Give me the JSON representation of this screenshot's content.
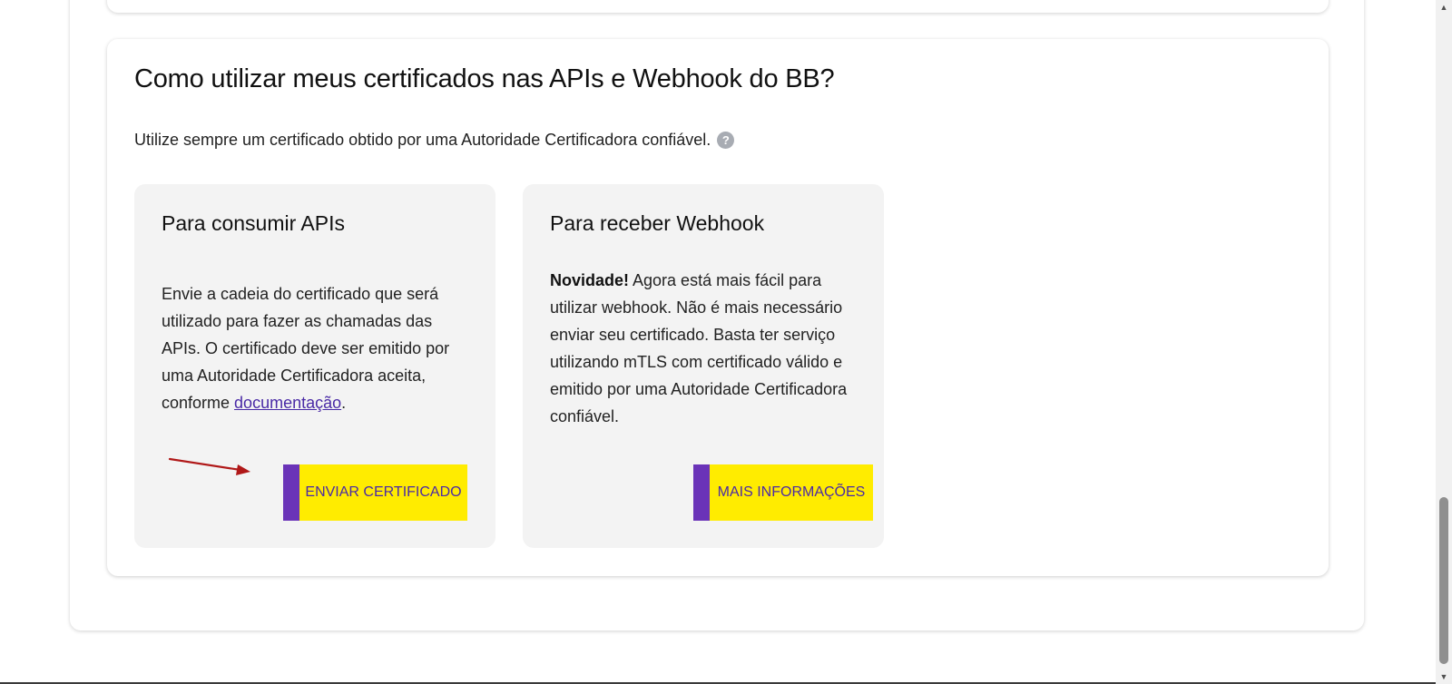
{
  "main_card": {
    "title": "Como utilizar meus certificados nas APIs e Webhook do BB?",
    "subtitle": "Utilize sempre um certificado obtido por uma Autoridade Certificadora confiável.",
    "help_icon_glyph": "?"
  },
  "api_card": {
    "title": "Para consumir APIs",
    "body_text": "Envie a cadeia do certificado que será utilizado para fazer as chamadas das APIs. O certificado deve ser emitido por uma Autoridade Certificadora aceita, conforme ",
    "link_text": "documentação",
    "body_end": ".",
    "button_label": "ENVIAR CERTIFICADO"
  },
  "webhook_card": {
    "title": "Para receber Webhook",
    "highlight": "Novidade!",
    "body_text": " Agora está mais fácil para utilizar webhook. Não é mais necessário enviar seu certificado. Basta ter serviço utilizando mTLS com certificado válido e emitido por uma Autoridade Certificadora confiável.",
    "button_label": "MAIS INFORMAÇÕES"
  },
  "colors": {
    "button_background": "#ffec00",
    "button_accent": "#6a33b8",
    "button_text": "#4a2aa6",
    "link": "#4a2aa6",
    "arrow": "#b01818"
  },
  "icons": {
    "help": "question-circle-icon",
    "annotation": "red-arrow-icon"
  }
}
